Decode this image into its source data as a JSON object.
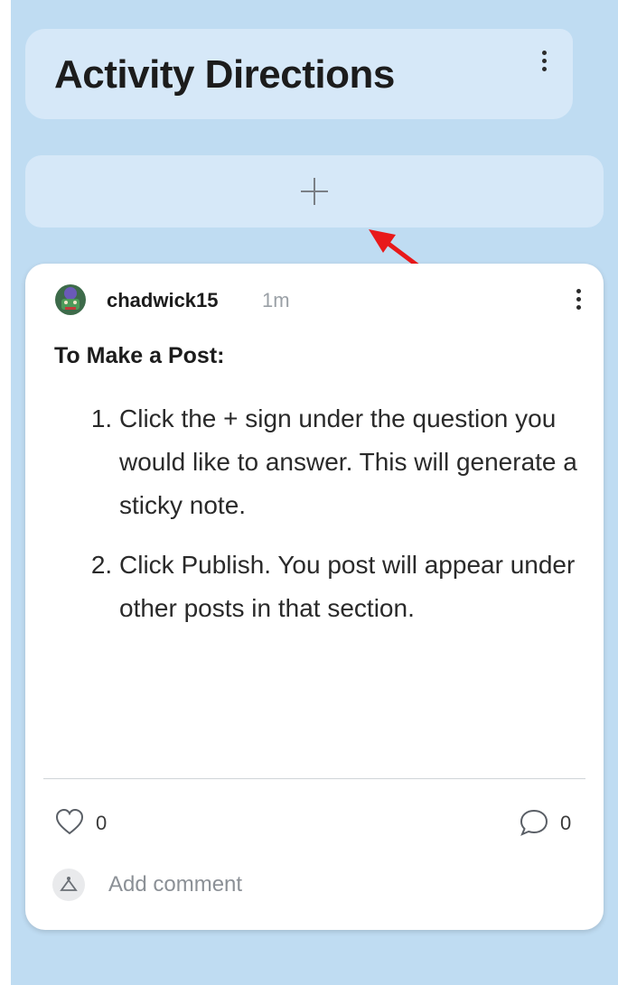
{
  "section": {
    "title": "Activity Directions",
    "menu_icon": "vertical-ellipsis-icon",
    "add_icon": "plus-icon"
  },
  "post": {
    "author": "chadwick15",
    "time": "1m",
    "heading": "To Make a Post:",
    "steps": [
      "Click the + sign under the question you would like to answer. This will generate a sticky note.",
      "Click Publish. You post will appear under other posts in that section."
    ],
    "likes": "0",
    "comments": "0",
    "add_comment_placeholder": "Add comment"
  },
  "colors": {
    "column_background": "#bfdcf2",
    "panel_background": "#d6e8f8",
    "annotation_arrow": "#e8191a"
  }
}
